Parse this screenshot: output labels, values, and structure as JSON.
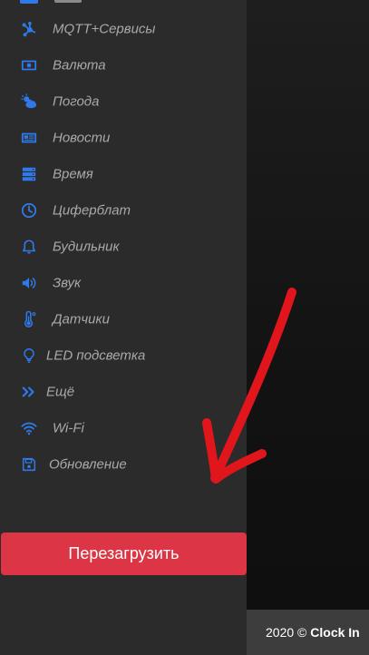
{
  "sidebar": {
    "items": [
      {
        "label": "MQTT+Сервисы",
        "icon": "hub-icon"
      },
      {
        "label": "Валюта",
        "icon": "money-bill-icon"
      },
      {
        "label": "Погода",
        "icon": "cloud-sun-icon"
      },
      {
        "label": "Новости",
        "icon": "newspaper-icon"
      },
      {
        "label": "Время",
        "icon": "server-icon"
      },
      {
        "label": "Циферблат",
        "icon": "clock-icon"
      },
      {
        "label": "Будильник",
        "icon": "bell-icon"
      },
      {
        "label": "Звук",
        "icon": "volume-icon"
      },
      {
        "label": "Датчики",
        "icon": "thermometer-icon"
      },
      {
        "label": "LED подсветка",
        "icon": "lightbulb-icon"
      },
      {
        "label": "Ещё",
        "icon": "double-chevron-right-icon"
      },
      {
        "label": "Wi-Fi",
        "icon": "wifi-icon"
      },
      {
        "label": "Обновление",
        "icon": "floppy-disk-icon"
      }
    ],
    "reboot_label": "Перезагрузить"
  },
  "footer": {
    "year": "2020",
    "copyright_symbol": "©",
    "brand": "Clock In"
  },
  "colors": {
    "accent": "#2f79e8",
    "danger": "#dc3545",
    "annotation": "#e0161c"
  }
}
